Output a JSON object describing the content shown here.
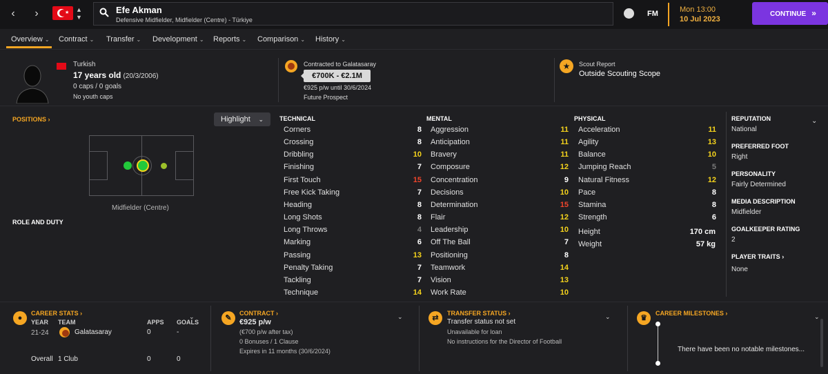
{
  "header": {
    "player_name": "Efe Akman",
    "player_role": "Defensive Midfielder, Midfielder (Centre) - Türkiye",
    "fm_label": "FM",
    "day": "Mon 13:00",
    "date": "10 Jul 2023",
    "continue_label": "CONTINUE"
  },
  "tabs": [
    {
      "label": "Overview"
    },
    {
      "label": "Contract"
    },
    {
      "label": "Transfer"
    },
    {
      "label": "Development"
    },
    {
      "label": "Reports"
    },
    {
      "label": "Comparison"
    },
    {
      "label": "History"
    }
  ],
  "info": {
    "nationality": "Turkish",
    "age": "17 years old",
    "dob": "(20/3/2006)",
    "caps": "0 caps / 0 goals",
    "youth_caps": "No youth caps",
    "contract_label": "Contracted to Galatasaray",
    "value_range": "€700K - €2.1M",
    "wage": "€925 p/w until 30/6/2024",
    "prospect": "Future Prospect",
    "scout_label": "Scout Report",
    "scout_value": "Outside Scouting Scope"
  },
  "left": {
    "positions_label": "POSITIONS",
    "highlight_label": "Highlight",
    "position_name": "Midfielder (Centre)",
    "role_duty_label": "ROLE AND DUTY"
  },
  "technical": {
    "heading": "TECHNICAL",
    "items": [
      {
        "name": "Corners",
        "value": "8"
      },
      {
        "name": "Crossing",
        "value": "8"
      },
      {
        "name": "Dribbling",
        "value": "10"
      },
      {
        "name": "Finishing",
        "value": "7"
      },
      {
        "name": "First Touch",
        "value": "15"
      },
      {
        "name": "Free Kick Taking",
        "value": "7"
      },
      {
        "name": "Heading",
        "value": "8"
      },
      {
        "name": "Long Shots",
        "value": "8"
      },
      {
        "name": "Long Throws",
        "value": "4"
      },
      {
        "name": "Marking",
        "value": "6"
      },
      {
        "name": "Passing",
        "value": "13"
      },
      {
        "name": "Penalty Taking",
        "value": "7"
      },
      {
        "name": "Tackling",
        "value": "7"
      },
      {
        "name": "Technique",
        "value": "14"
      }
    ]
  },
  "mental": {
    "heading": "MENTAL",
    "items": [
      {
        "name": "Aggression",
        "value": "11"
      },
      {
        "name": "Anticipation",
        "value": "11"
      },
      {
        "name": "Bravery",
        "value": "11"
      },
      {
        "name": "Composure",
        "value": "12"
      },
      {
        "name": "Concentration",
        "value": "9"
      },
      {
        "name": "Decisions",
        "value": "10"
      },
      {
        "name": "Determination",
        "value": "15"
      },
      {
        "name": "Flair",
        "value": "12"
      },
      {
        "name": "Leadership",
        "value": "10"
      },
      {
        "name": "Off The Ball",
        "value": "7"
      },
      {
        "name": "Positioning",
        "value": "8"
      },
      {
        "name": "Teamwork",
        "value": "14"
      },
      {
        "name": "Vision",
        "value": "13"
      },
      {
        "name": "Work Rate",
        "value": "10"
      }
    ]
  },
  "physical": {
    "heading": "PHYSICAL",
    "items": [
      {
        "name": "Acceleration",
        "value": "11"
      },
      {
        "name": "Agility",
        "value": "13"
      },
      {
        "name": "Balance",
        "value": "10"
      },
      {
        "name": "Jumping Reach",
        "value": "5"
      },
      {
        "name": "Natural Fitness",
        "value": "12"
      },
      {
        "name": "Pace",
        "value": "8"
      },
      {
        "name": "Stamina",
        "value": "8"
      },
      {
        "name": "Strength",
        "value": "6"
      }
    ],
    "height_label": "Height",
    "height_value": "170 cm",
    "weight_label": "Weight",
    "weight_value": "57 kg"
  },
  "side": {
    "reputation_h": "REPUTATION",
    "reputation_v": "National",
    "foot_h": "PREFERRED FOOT",
    "foot_v": "Right",
    "personality_h": "PERSONALITY",
    "personality_v": "Fairly Determined",
    "media_h": "MEDIA DESCRIPTION",
    "media_v": "Midfielder",
    "gk_h": "GOALKEEPER RATING",
    "gk_v": "2",
    "traits_h": "PLAYER TRAITS",
    "traits_v": "None"
  },
  "career": {
    "heading": "CAREER STATS",
    "col_year": "YEAR",
    "col_team": "TEAM",
    "col_apps": "APPS",
    "col_goals": "GOALS",
    "row_year": "21-24",
    "row_team": "Galatasaray",
    "row_apps": "0",
    "row_goals": "-",
    "overall_label": "Overall",
    "overall_team": "1 Club",
    "overall_apps": "0",
    "overall_goals": "0"
  },
  "contract": {
    "heading": "CONTRACT",
    "wage": "€925 p/w",
    "after_tax": "(€700 p/w after tax)",
    "bonuses": "0 Bonuses / 1 Clause",
    "expires": "Expires in 11 months (30/6/2024)"
  },
  "transfer": {
    "heading": "TRANSFER STATUS",
    "status": "Transfer status not set",
    "loan": "Unavailable for loan",
    "instructions": "No instructions for the Director of Football"
  },
  "milestones": {
    "heading": "CAREER MILESTONES",
    "text": "There have been no notable milestones..."
  },
  "colors": {
    "accent": "#f5a623",
    "continue": "#7b35e0",
    "attr_low": "#7a7a7a",
    "attr_mid": "#ffffff",
    "attr_good": "#f5d31c",
    "attr_high": "#f0452b"
  }
}
